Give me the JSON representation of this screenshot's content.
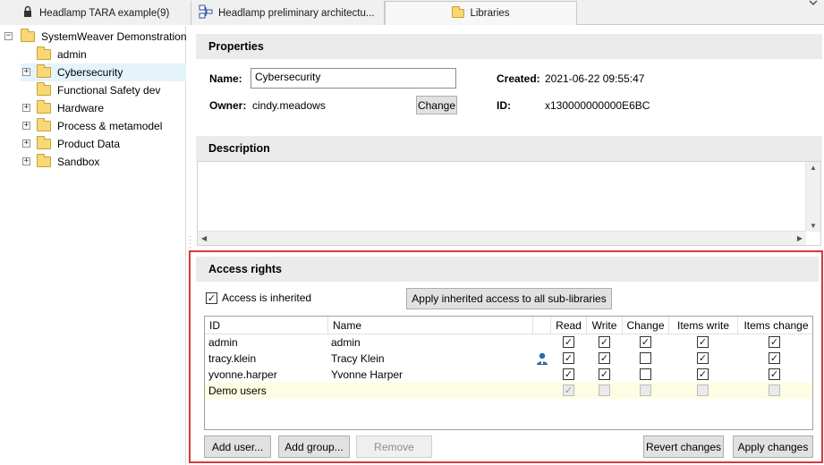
{
  "tabs": [
    {
      "label": "Headlamp TARA example(9)",
      "icon": "lock-icon"
    },
    {
      "label": "Headlamp preliminary architectu...",
      "icon": "diagram-icon"
    },
    {
      "label": "Libraries",
      "icon": "folder-icon"
    }
  ],
  "tree": {
    "root": "SystemWeaver Demonstration",
    "items": [
      {
        "label": "admin",
        "expandable": false,
        "selected": false
      },
      {
        "label": "Cybersecurity",
        "expandable": true,
        "selected": true
      },
      {
        "label": "Functional Safety dev",
        "expandable": false,
        "selected": false
      },
      {
        "label": "Hardware",
        "expandable": true,
        "selected": false
      },
      {
        "label": "Process & metamodel",
        "expandable": true,
        "selected": false
      },
      {
        "label": "Product Data",
        "expandable": true,
        "selected": false
      },
      {
        "label": "Sandbox",
        "expandable": true,
        "selected": false
      }
    ]
  },
  "properties": {
    "heading": "Properties",
    "name_label": "Name:",
    "name_value": "Cybersecurity",
    "owner_label": "Owner:",
    "owner_value": "cindy.meadows",
    "change_label": "Change",
    "created_label": "Created:",
    "created_value": "2021-06-22 09:55:47",
    "id_label": "ID:",
    "id_value": "x130000000000E6BC"
  },
  "description": {
    "heading": "Description",
    "text": ""
  },
  "access": {
    "heading": "Access rights",
    "inherited_label": "Access is inherited",
    "inherited_checked": true,
    "apply_inherited_label": "Apply inherited access to all sub-libraries",
    "columns": [
      "ID",
      "Name",
      "",
      "Read",
      "Write",
      "Change",
      "Items write",
      "Items change"
    ],
    "rows": [
      {
        "id": "admin",
        "name": "admin",
        "icon": false,
        "group": false,
        "read": true,
        "write": true,
        "change": true,
        "items_write": true,
        "items_change": true
      },
      {
        "id": "tracy.klein",
        "name": "Tracy Klein",
        "icon": true,
        "group": false,
        "read": true,
        "write": true,
        "change": false,
        "items_write": true,
        "items_change": true
      },
      {
        "id": "yvonne.harper",
        "name": "Yvonne Harper",
        "icon": false,
        "group": false,
        "read": true,
        "write": true,
        "change": false,
        "items_write": true,
        "items_change": true
      },
      {
        "id": "Demo users",
        "name": "",
        "icon": false,
        "group": true,
        "read": true,
        "write": false,
        "change": false,
        "items_write": false,
        "items_change": false
      }
    ],
    "buttons": {
      "add_user": "Add user...",
      "add_group": "Add group...",
      "remove": "Remove",
      "revert": "Revert changes",
      "apply": "Apply changes"
    }
  },
  "colors": {
    "highlight": "#d9393f",
    "selection": "#e5f3fb",
    "group_row": "#fdfde3"
  }
}
